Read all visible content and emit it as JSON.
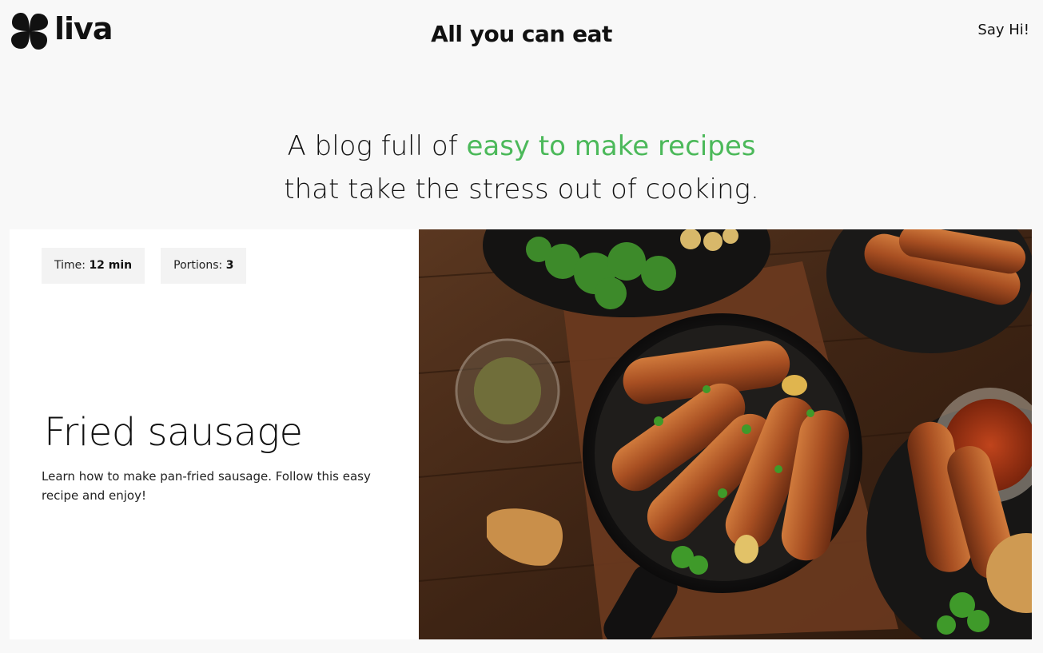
{
  "header": {
    "logo_text": "liva",
    "site_title": "All you can eat",
    "contact_label": "Say Hi!"
  },
  "hero": {
    "line1_prefix": "A blog full of ",
    "line1_accent": "easy to make recipes",
    "line2": "that take the stress out of cooking."
  },
  "recipe": {
    "time_label": "Time:",
    "time_value": "12 min",
    "portions_label": "Portions:",
    "portions_value": "3",
    "title": "Fried sausage",
    "description": "Learn how to make pan-fried sausage. Follow this easy recipe and enjoy!"
  },
  "colors": {
    "accent": "#4cb95a",
    "background": "#f8f8f8",
    "card": "#ffffff",
    "chip": "#f3f3f3"
  }
}
